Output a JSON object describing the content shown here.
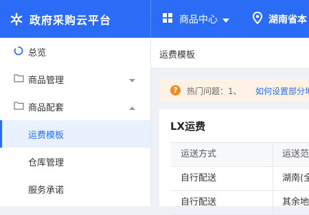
{
  "header": {
    "brand": "政府采购云平台",
    "nav_center": "商品中心",
    "region": "湖南省本"
  },
  "sidebar": {
    "items": [
      {
        "label": "总览"
      },
      {
        "label": "商品管理"
      },
      {
        "label": "商品配套"
      },
      {
        "label": "运费模板"
      },
      {
        "label": "仓库管理"
      },
      {
        "label": "服务承诺"
      }
    ]
  },
  "main": {
    "tab_title": "运费模板",
    "notice": {
      "label": "热门问题：1、",
      "link": "如何设置部分地"
    },
    "card": {
      "title": "LX运费",
      "table": {
        "headers": [
          "运送方式",
          "运送范"
        ],
        "rows": [
          [
            "自行配送",
            "湖南(全"
          ],
          [
            "自行配送",
            "其余地"
          ]
        ]
      }
    }
  },
  "colors": {
    "brand_blue": "#2a6cf6",
    "notice_bg": "#fdf2e5",
    "notice_icon": "#f08c21"
  }
}
